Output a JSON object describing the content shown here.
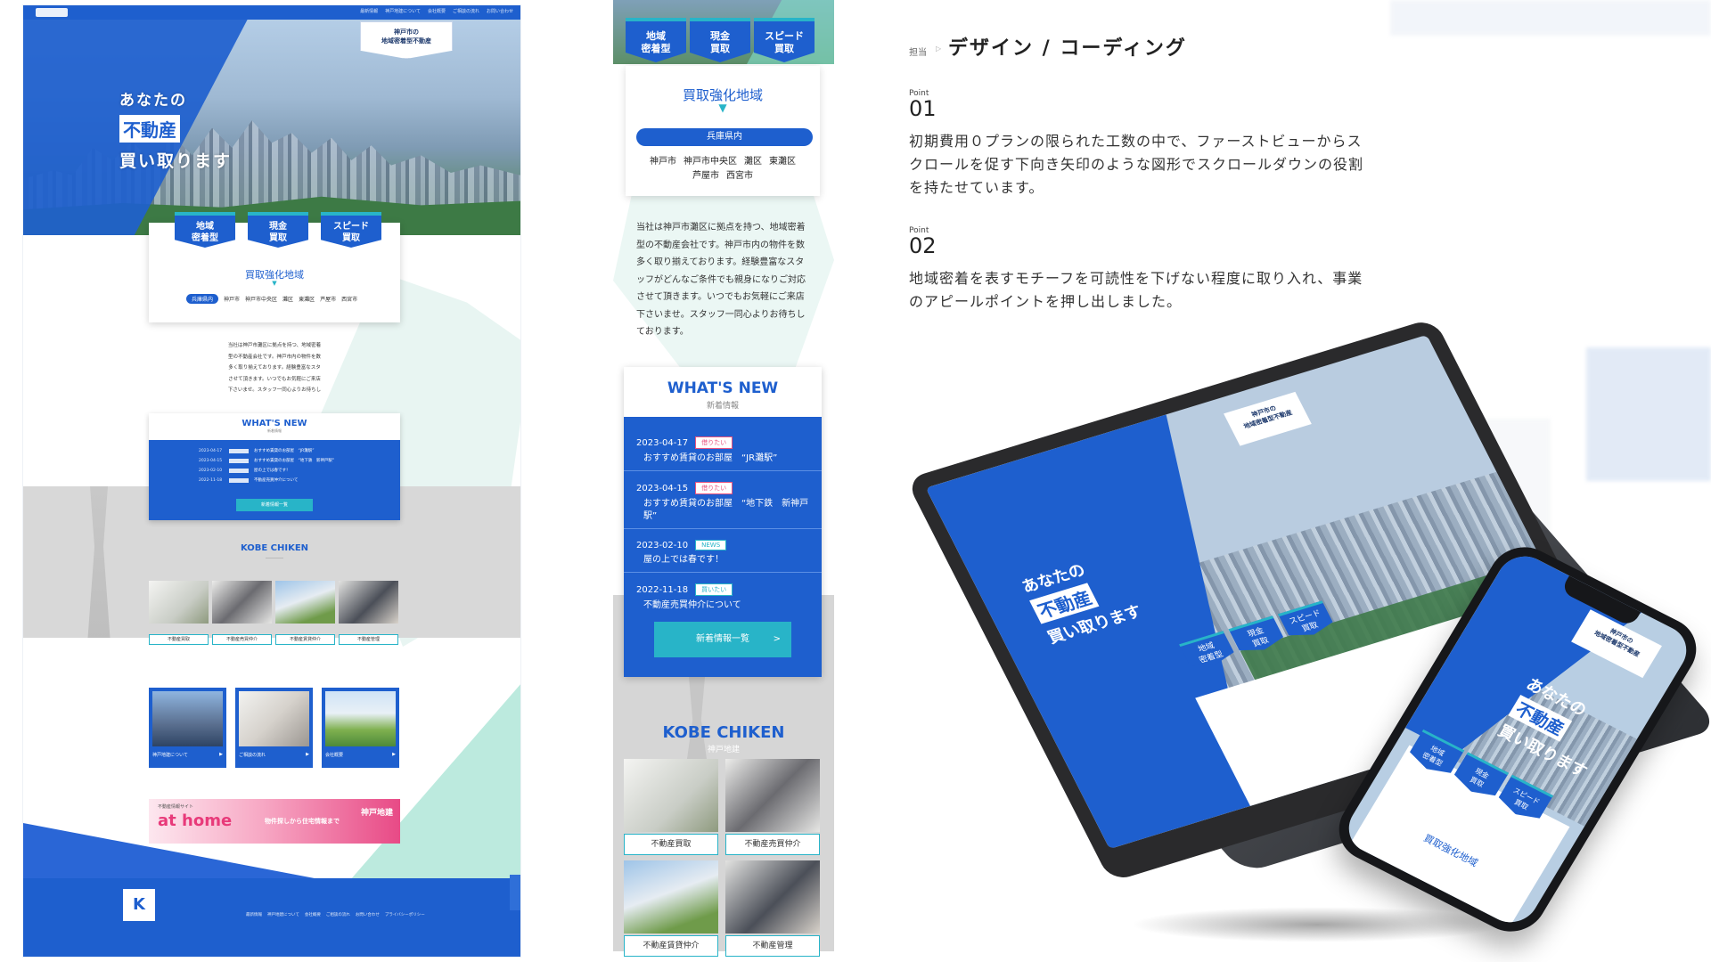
{
  "header": {
    "role_label": "担当",
    "role_title": "デザイン / コーディング"
  },
  "points": [
    {
      "label": "Point",
      "number": "01",
      "text": "初期費用０プランの限られた工数の中で、ファーストビューからスクロールを促す下向き矢印のような図形でスクロールダウンの役割を持たせています。"
    },
    {
      "label": "Point",
      "number": "02",
      "text": "地域密着を表すモチーフを可読性を下げない程度に取り入れ、事業のアピールポイントを押し出しました。"
    }
  ],
  "site": {
    "tagline": [
      "神戸市の",
      "地域密着型不動産"
    ],
    "catch": [
      "あなたの",
      "不動産",
      "買い取ります"
    ],
    "badges": [
      [
        "地域",
        "密着型"
      ],
      [
        "現金",
        "買取"
      ],
      [
        "スピード",
        "買取"
      ]
    ],
    "area_title": "買取強化地域",
    "area_arrow": "▼",
    "area_pill": "兵庫県内",
    "cities_row1": [
      "神戸市",
      "神戸市中央区",
      "灘区",
      "東灘区"
    ],
    "cities_row2": [
      "芦屋市",
      "西宮市"
    ],
    "intro_mobile": [
      "当社は神戸市灘区に拠点を持つ、地域密着",
      "型の不動産会社です。神戸市内の物件を数",
      "多く取り揃えております。経験豊富なスタ",
      "ッフがどんなご条件でも親身になりご対応",
      "させて頂きます。いつでもお気軽にご来店",
      "下さいませ。スタッフ一同心よりお待ちし",
      "ております。"
    ],
    "news_title": "WHAT'S NEW",
    "news_sub": "新着情報",
    "news": [
      {
        "date": "2023-04-17",
        "cat": "借りたい",
        "cat_color": "#e8527e",
        "title": "おすすめ賃貸のお部屋　“JR灘駅”"
      },
      {
        "date": "2023-04-15",
        "cat": "借りたい",
        "cat_color": "#e8527e",
        "title": "おすすめ賃貸のお部屋　“地下鉄　新神戸駅”"
      },
      {
        "date": "2023-02-10",
        "cat": "NEWS",
        "cat_color": "#28b4c8",
        "title": "屋の上では春です！"
      },
      {
        "date": "2022-11-18",
        "cat": "買いたい",
        "cat_color": "#28b4c8",
        "title": "不動産売買仲介について"
      }
    ],
    "news_button": "新着情報一覧",
    "news_button_glyph": ">",
    "kobe_title": "KOBE CHIKEN",
    "kobe_sub": "神戸地建",
    "services": [
      "不動産買取",
      "不動産売買仲介",
      "不動産賃貸仲介",
      "不動産管理"
    ],
    "tiles": [
      "神戸地建について",
      "ご相談の流れ",
      "会社概要"
    ],
    "banner": {
      "small": "不動産情報サイト",
      "brand": "at home",
      "middle": "物件探しから住宅情報まで",
      "right": "神戸地建"
    },
    "footer_logo": "K",
    "footer_nav": [
      "最新情報",
      "神戸地建について",
      "会社概要",
      "ご相談の流れ",
      "お問い合わせ",
      "プライバシーポリシー"
    ],
    "top_nav": [
      "最新情報",
      "神戸地建について",
      "会社概要",
      "ご相談の流れ",
      "お問い合わせ"
    ]
  },
  "colors": {
    "primary": "#1e5fce",
    "accent": "#28b4c8",
    "mint": "#8fdcc8",
    "pink": "#e8527e"
  }
}
